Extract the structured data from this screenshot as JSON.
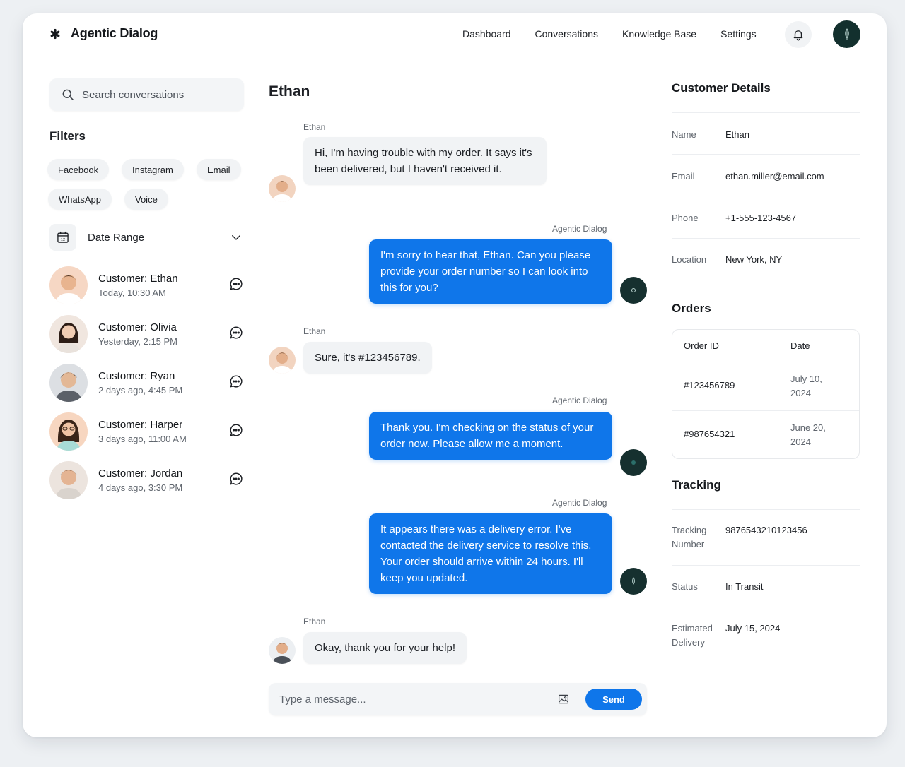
{
  "app": {
    "name": "Agentic Dialog"
  },
  "nav": {
    "items": [
      "Dashboard",
      "Conversations",
      "Knowledge Base",
      "Settings"
    ]
  },
  "search": {
    "placeholder": "Search conversations"
  },
  "filters": {
    "title": "Filters",
    "chips": [
      "Facebook",
      "Instagram",
      "Email",
      "WhatsApp",
      "Voice"
    ],
    "date_range_label": "Date Range",
    "calendar_day": "12"
  },
  "conversations": [
    {
      "name": "Customer: Ethan",
      "time": "Today, 10:30 AM",
      "skin": "#e8b48f",
      "hair": "#4a3020"
    },
    {
      "name": "Customer: Olivia",
      "time": "Yesterday, 2:15 PM",
      "skin": "#f1cdb3",
      "hair": "#2d1d16"
    },
    {
      "name": "Customer: Ryan",
      "time": "2 days ago, 4:45 PM",
      "skin": "#e3b896",
      "hair": "#3a2a20"
    },
    {
      "name": "Customer: Harper",
      "time": "3 days ago, 11:00 AM",
      "skin": "#f0c3a4",
      "hair": "#3a2418"
    },
    {
      "name": "Customer: Jordan",
      "time": "4 days ago, 3:30 PM",
      "skin": "#e4b493",
      "hair": "#3b2a1f"
    }
  ],
  "chat": {
    "title": "Ethan",
    "messages": [
      {
        "from": "customer",
        "sender": "Ethan",
        "text": "Hi, I'm having trouble with my order. It says it's been delivered, but I haven't received it."
      },
      {
        "from": "agent",
        "sender": "Agentic Dialog",
        "text": "I'm sorry to hear that, Ethan. Can you please provide your order number so I can look into this for you?"
      },
      {
        "from": "customer",
        "sender": "Ethan",
        "text": "Sure, it's #123456789."
      },
      {
        "from": "agent",
        "sender": "Agentic Dialog",
        "text": "Thank you. I'm checking on the status of your order now. Please allow me a moment."
      },
      {
        "from": "agent",
        "sender": "Agentic Dialog",
        "text": "It appears there was a delivery error. I've contacted the delivery service to resolve this. Your order should arrive within 24 hours. I'll keep you updated."
      },
      {
        "from": "customer",
        "sender": "Ethan",
        "text": "Okay, thank you for your help!"
      }
    ],
    "composer_placeholder": "Type a message...",
    "send_label": "Send"
  },
  "customer": {
    "title": "Customer Details",
    "fields": [
      {
        "label": "Name",
        "value": "Ethan"
      },
      {
        "label": "Email",
        "value": "ethan.miller@email.com"
      },
      {
        "label": "Phone",
        "value": "+1-555-123-4567"
      },
      {
        "label": "Location",
        "value": "New York, NY"
      }
    ]
  },
  "orders": {
    "title": "Orders",
    "headers": [
      "Order ID",
      "Date"
    ],
    "rows": [
      {
        "id": "#123456789",
        "date": "July 10, 2024"
      },
      {
        "id": "#987654321",
        "date": "June 20, 2024"
      }
    ]
  },
  "tracking": {
    "title": "Tracking",
    "fields": [
      {
        "label": "Tracking Number",
        "value": "9876543210123456"
      },
      {
        "label": "Status",
        "value": "In Transit"
      },
      {
        "label": "Estimated Delivery",
        "value": "July 15, 2024"
      }
    ]
  },
  "colors": {
    "accent": "#0f76ea",
    "bot_avatar": "#16302f",
    "surface": "#f1f3f5"
  },
  "icons": [
    "asterisk-logo-icon",
    "bell-icon",
    "search-icon",
    "calendar-icon",
    "chevron-down-icon",
    "chat-bubble-icon",
    "image-icon"
  ]
}
